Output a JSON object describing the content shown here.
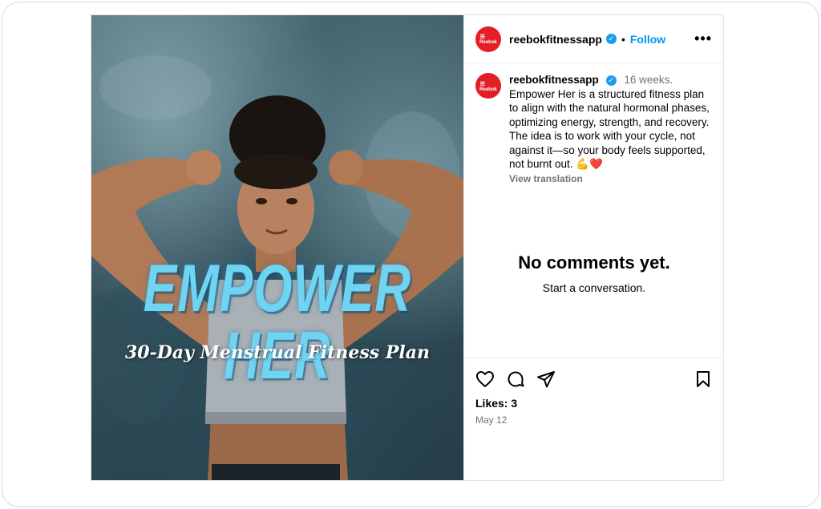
{
  "post": {
    "username": "reebokfitnessapp",
    "avatar_text": "Reebok",
    "follow_label": "Follow",
    "separator": "•",
    "more_label": "•••",
    "verified_mark": "✓"
  },
  "media": {
    "title": "EMPOWER HER",
    "subtitle": "30-Day Menstrual Fitness Plan"
  },
  "caption": {
    "username": "reebokfitnessapp",
    "time_ago": "16 weeks.",
    "text": "Empower Her is a structured fitness plan to align with the natural hormonal phases, optimizing energy, strength, and recovery. The idea is to work with your cycle, not against it—so your body feels supported, not burnt out. 💪❤️",
    "view_translation": "View translation"
  },
  "comments": {
    "empty_title": "No comments yet.",
    "empty_subtitle": "Start a conversation."
  },
  "footer": {
    "likes": "Likes: 3",
    "date": "May 12"
  },
  "icons": [
    "heart-icon",
    "comment-icon",
    "share-icon",
    "bookmark-icon",
    "verified-icon",
    "more-icon"
  ],
  "colors": {
    "follow": "#0095f6",
    "verified": "#1d9bf0",
    "brand": "#e41e26",
    "muted": "#737373"
  }
}
